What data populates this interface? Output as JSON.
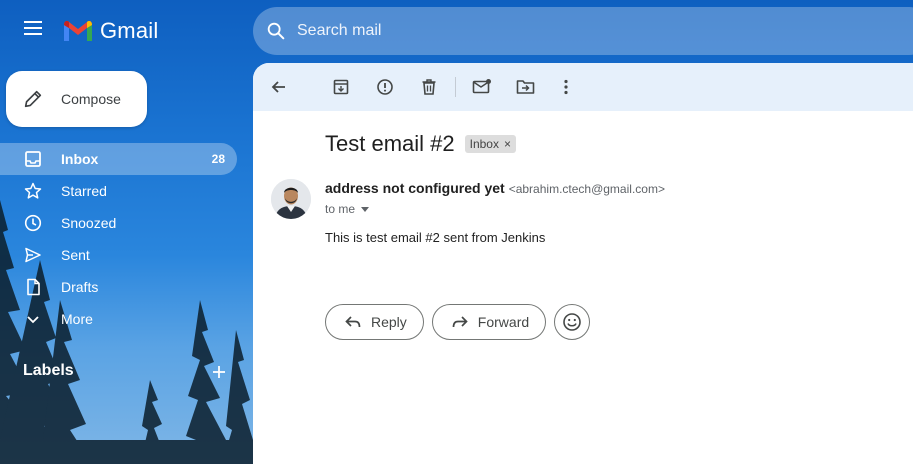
{
  "app": {
    "name": "Gmail"
  },
  "search": {
    "placeholder": "Search mail"
  },
  "compose": {
    "label": "Compose"
  },
  "nav": {
    "items": [
      {
        "label": "Inbox",
        "count": "28",
        "icon": "inbox-icon"
      },
      {
        "label": "Starred",
        "icon": "star-icon"
      },
      {
        "label": "Snoozed",
        "icon": "clock-icon"
      },
      {
        "label": "Sent",
        "icon": "send-icon"
      },
      {
        "label": "Drafts",
        "icon": "draft-icon"
      },
      {
        "label": "More",
        "icon": "chevron-down-icon"
      }
    ]
  },
  "labels": {
    "heading": "Labels"
  },
  "message": {
    "subject": "Test email #2",
    "tag": "Inbox",
    "sender_name": "address not configured yet",
    "sender_email": "<abrahim.ctech@gmail.com>",
    "to": "to me",
    "body": "This is test email #2 sent from Jenkins"
  },
  "actions": {
    "reply": "Reply",
    "forward": "Forward"
  },
  "colors": {
    "accent": "#1a73e8",
    "toolbar_bg": "#e6f0fb"
  }
}
